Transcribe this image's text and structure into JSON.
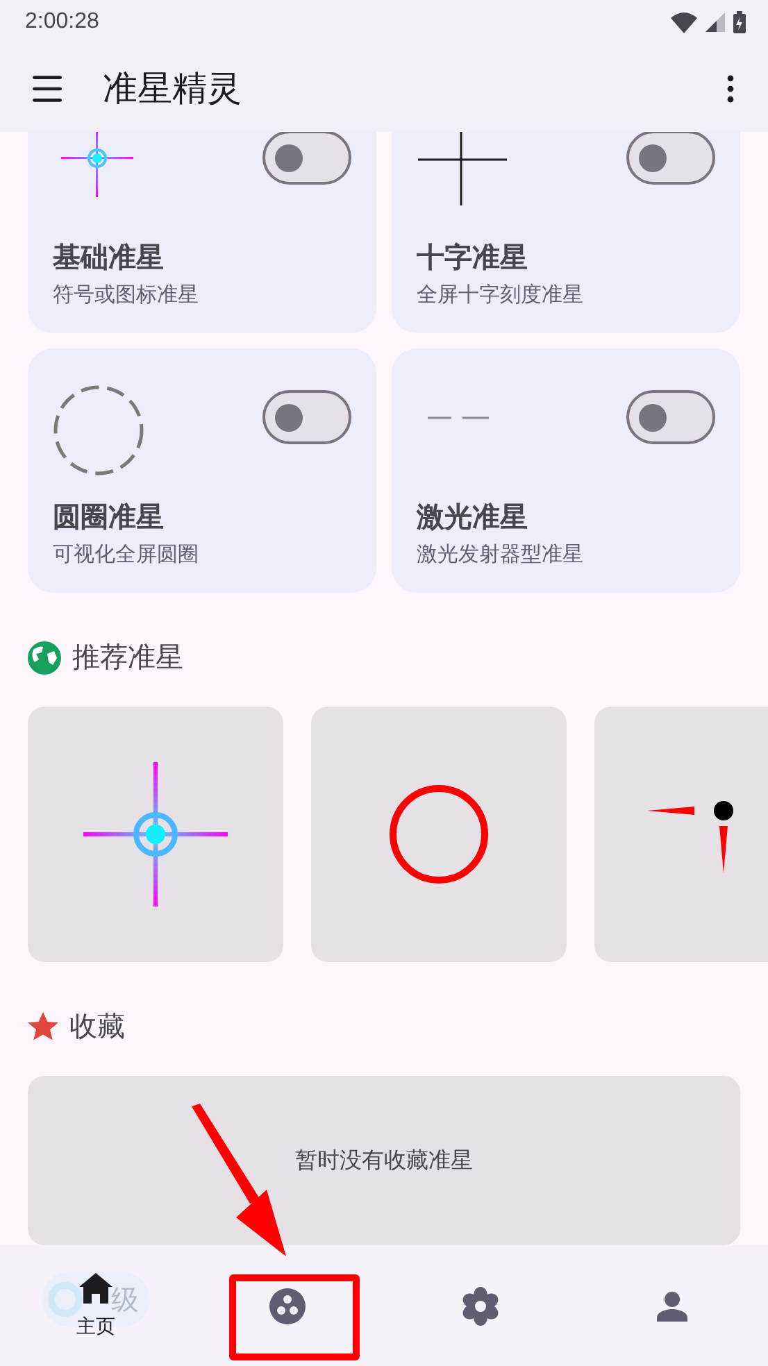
{
  "status_bar": {
    "time": "2:00:28"
  },
  "app_bar": {
    "title": "准星精灵"
  },
  "crosshair_types": [
    {
      "kind": "basic",
      "title": "基础准星",
      "subtitle": "符号或图标准星",
      "on": false
    },
    {
      "kind": "cross",
      "title": "十字准星",
      "subtitle": "全屏十字刻度准星",
      "on": false
    },
    {
      "kind": "circle",
      "title": "圆圈准星",
      "subtitle": "可视化全屏圆圈",
      "on": false
    },
    {
      "kind": "laser",
      "title": "激光准星",
      "subtitle": "激光发射器型准星",
      "on": false
    }
  ],
  "recommended": {
    "title": "推荐准星",
    "items": [
      {
        "kind": "gradient_cross"
      },
      {
        "kind": "red_circle"
      },
      {
        "kind": "red_ticks"
      }
    ]
  },
  "favorites": {
    "title": "收藏",
    "empty_text": "暂时没有收藏准星"
  },
  "next_section": {
    "title": "级"
  },
  "bottom_nav": [
    {
      "kind": "home",
      "label": "主页",
      "selected": true,
      "highlighted": false
    },
    {
      "kind": "palette",
      "selected": false,
      "highlighted": true
    },
    {
      "kind": "flower",
      "selected": false,
      "highlighted": false
    },
    {
      "kind": "person",
      "selected": false,
      "highlighted": false
    }
  ]
}
